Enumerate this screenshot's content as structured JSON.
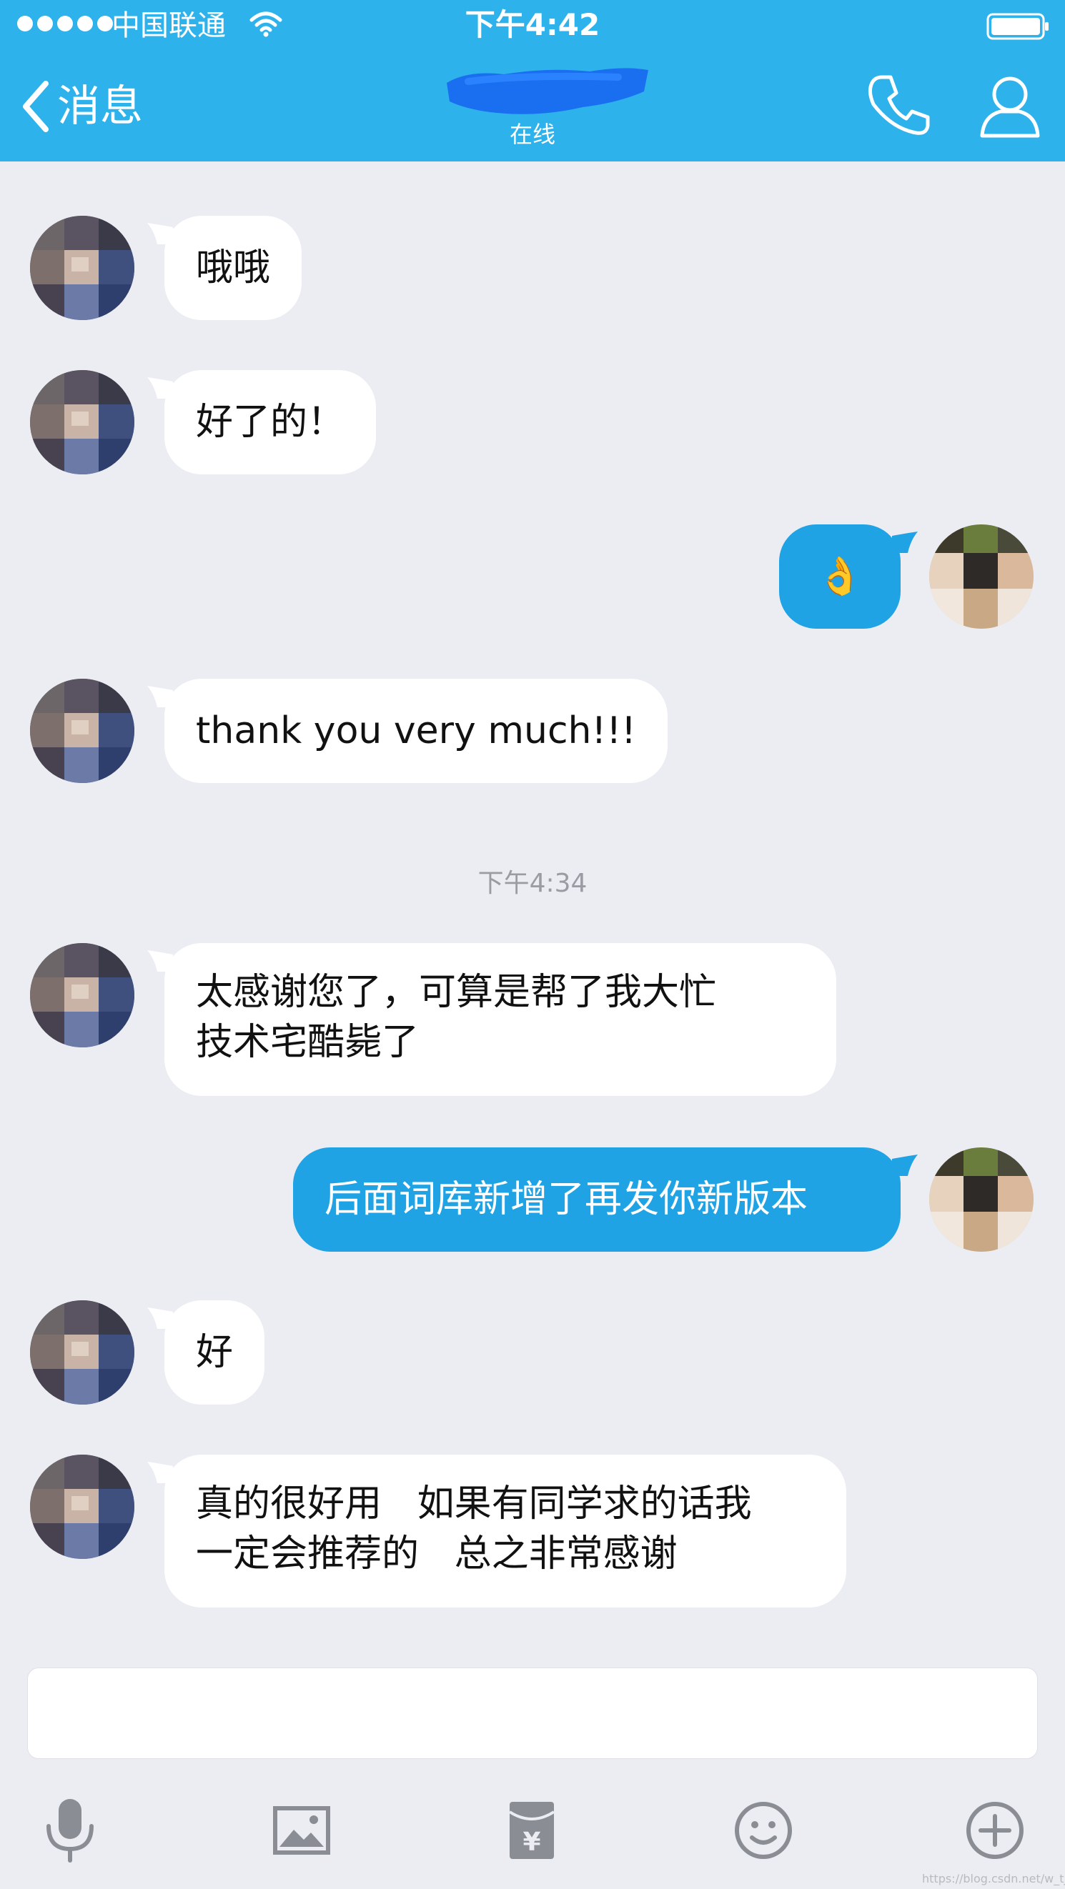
{
  "status_bar": {
    "carrier": "中国联通",
    "time": "下午4:42"
  },
  "nav": {
    "back_label": "消息",
    "contact_status": "在线"
  },
  "colors": {
    "header": "#2eb2ec",
    "outgoing_bubble": "#1fa3e4",
    "incoming_bubble": "#ffffff",
    "background": "#ebedf2"
  },
  "messages": [
    {
      "side": "in",
      "text": "哦哦"
    },
    {
      "side": "in",
      "text": "好了的！"
    },
    {
      "side": "out",
      "text": "👌"
    },
    {
      "side": "in",
      "text": "thank you very much!!!"
    },
    {
      "side": "in",
      "lines": [
        "太感谢您了，可算是帮了我大忙",
        "技术宅酷毙了"
      ]
    },
    {
      "side": "out",
      "text": "后面词库新增了再发你新版本"
    },
    {
      "side": "in",
      "text": "好"
    },
    {
      "side": "in",
      "lines": [
        "真的很好用   如果有同学求的话我",
        "一定会推荐的   总之非常感谢"
      ]
    }
  ],
  "timestamp": "下午4:34",
  "toolbar": [
    "microphone-icon",
    "image-icon",
    "red-packet-icon",
    "emoji-icon",
    "plus-icon"
  ],
  "watermark": "https://blog.csdn.net/w_tj"
}
